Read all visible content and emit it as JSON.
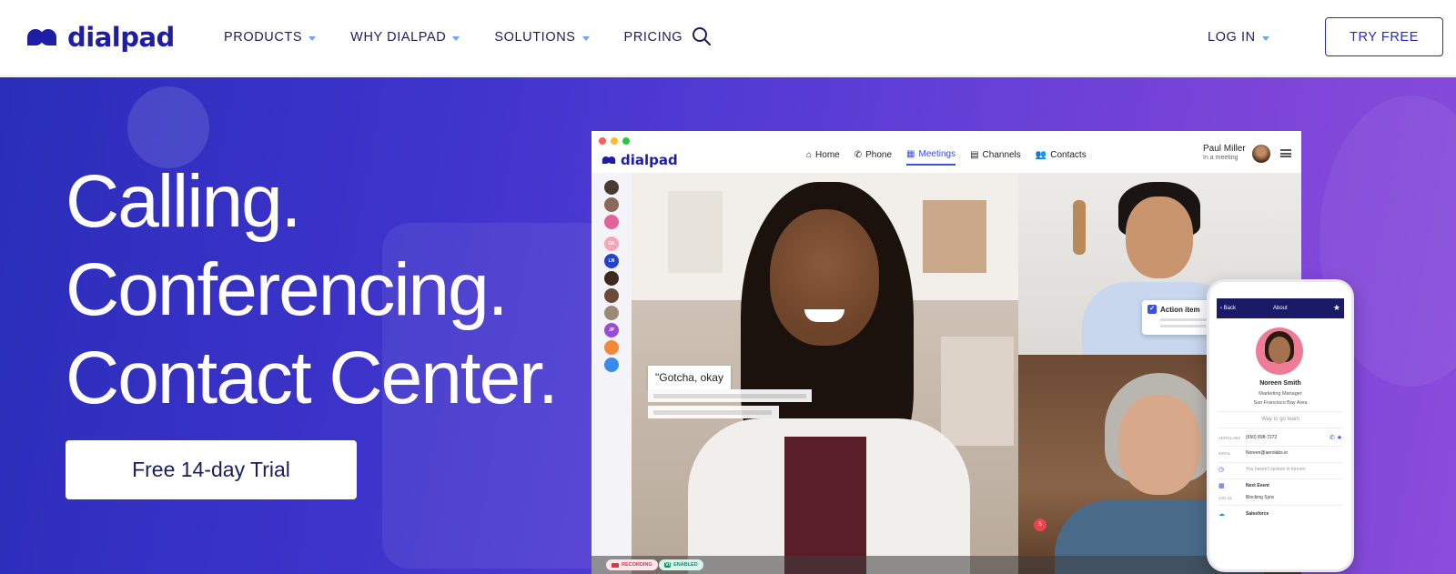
{
  "brand": {
    "name": "dialpad",
    "colors": {
      "brand": "#1d1da8",
      "accent": "#2a2ac4",
      "caret": "#6da6ee",
      "hero_start": "#2a2dba",
      "hero_end": "#8a4cdb"
    }
  },
  "nav": {
    "items": [
      {
        "label": "PRODUCTS",
        "dropdown": true
      },
      {
        "label": "WHY DIALPAD",
        "dropdown": true
      },
      {
        "label": "SOLUTIONS",
        "dropdown": true
      },
      {
        "label": "PRICING",
        "dropdown": false
      }
    ],
    "search_icon": "search-icon",
    "login_label": "LOG IN",
    "try_free_label": "TRY FREE"
  },
  "hero": {
    "headline": [
      "Calling.",
      "Conferencing.",
      "Contact Center."
    ],
    "cta_label": "Free 14-day Trial"
  },
  "app": {
    "logo": "dialpad",
    "tabs": [
      {
        "label": "Home",
        "icon": "home-icon",
        "active": false
      },
      {
        "label": "Phone",
        "icon": "phone-icon",
        "active": false
      },
      {
        "label": "Meetings",
        "icon": "calendar-icon",
        "active": true
      },
      {
        "label": "Channels",
        "icon": "chat-icon",
        "active": false
      },
      {
        "label": "Contacts",
        "icon": "contacts-icon",
        "active": false
      }
    ],
    "user": {
      "name": "Paul Miller",
      "status": "In a meeting"
    },
    "rail_initials": [
      "EK",
      "LN",
      "JP"
    ],
    "caption": "\"Gotcha, okay",
    "action_item_label": "Action item",
    "recording_label": "RECORDING",
    "vi_label": "Vi",
    "enabled_label": "ENABLED",
    "rec_badge": "5"
  },
  "phone": {
    "back_label": "Back",
    "title": "About",
    "contact": {
      "name": "Noreen Smith",
      "role": "Marketing Manager",
      "location": "San Francisco Bay Area",
      "tagline": "Way to go team"
    },
    "rows": [
      {
        "key": "AEROLABS",
        "value": "(650) 898-7272"
      },
      {
        "key": "EMAIL",
        "value": "Noreen@aerolabs.io"
      },
      {
        "key": "",
        "value": "You haven't spoken in forever"
      },
      {
        "key": "",
        "value": "Next Event"
      },
      {
        "key": "JAN 31",
        "value": "Blocking Sync"
      },
      {
        "key": "",
        "value": "Salesforce"
      }
    ]
  }
}
